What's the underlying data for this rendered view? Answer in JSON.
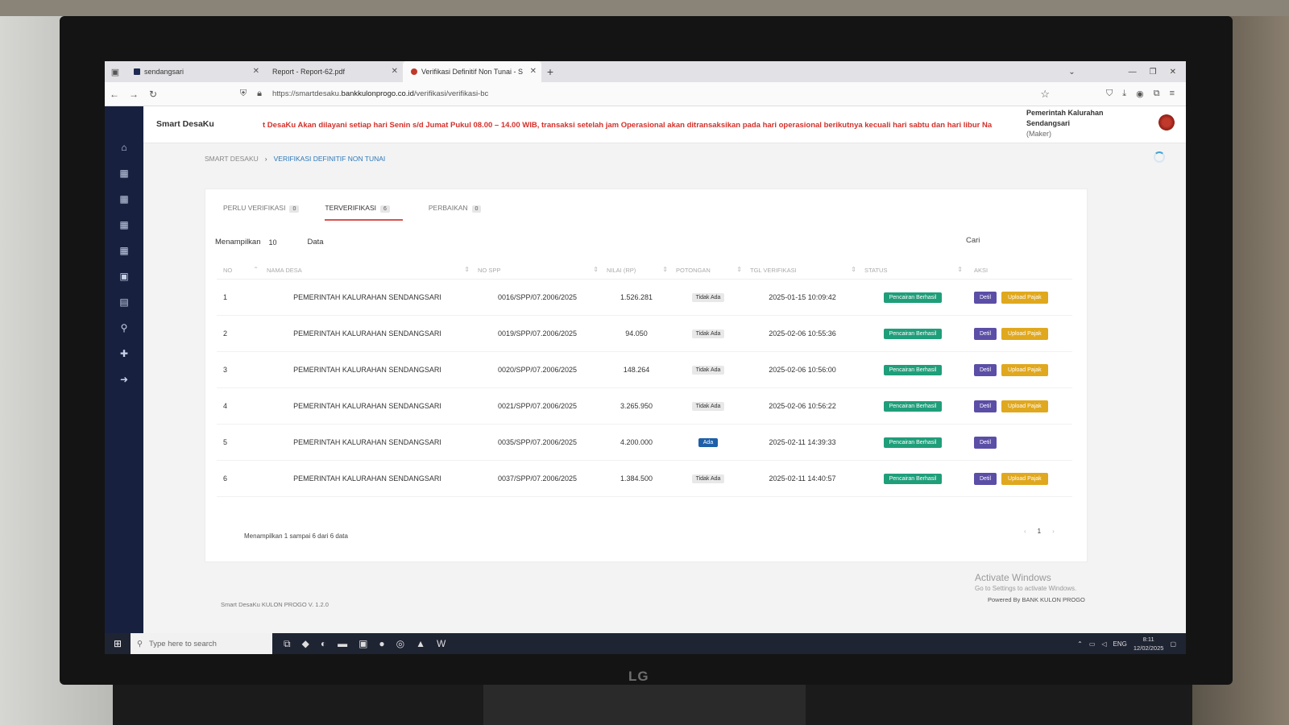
{
  "browser": {
    "tabs": [
      {
        "title": "sendangsari",
        "active": false
      },
      {
        "title": "Report - Report-62.pdf",
        "active": false
      },
      {
        "title": "Verifikasi Definitif Non Tunai - S",
        "active": true
      }
    ],
    "url_prefix": "https://smartdesaku.",
    "url_domain": "bankkulonprogo.co.id",
    "url_path": "/verifikasi/verifikasi-bc"
  },
  "header": {
    "brand": "Smart DesaKu",
    "announcement": "t DesaKu Akan dilayani setiap hari Senin s/d Jumat Pukul 08.00 – 14.00 WIB, transaksi setelah jam Operasional akan ditransaksikan pada hari operasional berikutnya kecuali hari sabtu dan hari libur Na",
    "user_line1": "Pemerintah Kalurahan",
    "user_line2": "Sendangsari",
    "user_role": "(Maker)"
  },
  "breadcrumb": {
    "root": "SMART DESAKU",
    "current": "VERIFIKASI DEFINITIF NON TUNAI"
  },
  "tabs": [
    {
      "label": "PERLU VERIFIKASI",
      "count": "0"
    },
    {
      "label": "TERVERIFIKASI",
      "count": "6"
    },
    {
      "label": "PERBAIKAN",
      "count": "0"
    }
  ],
  "controls": {
    "show_label": "Menampilkan",
    "page_size": "10",
    "data_label": "Data",
    "search_label": "Cari"
  },
  "columns": [
    "NO",
    "NAMA DESA",
    "NO SPP",
    "NILAI (RP)",
    "POTONGAN",
    "TGL VERIFIKASI",
    "STATUS",
    "AKSI"
  ],
  "rows": [
    {
      "no": "1",
      "desa": "PEMERINTAH KALURAHAN SENDANGSARI",
      "spp": "0016/SPP/07.2006/2025",
      "nilai": "1.526.281",
      "potongan": "Tidak Ada",
      "tgl": "2025-01-15 10:09:42",
      "status": "Pencairan Berhasil",
      "detil": "Detil",
      "upload": "Upload Pajak"
    },
    {
      "no": "2",
      "desa": "PEMERINTAH KALURAHAN SENDANGSARI",
      "spp": "0019/SPP/07.2006/2025",
      "nilai": "94.050",
      "potongan": "Tidak Ada",
      "tgl": "2025-02-06 10:55:36",
      "status": "Pencairan Berhasil",
      "detil": "Detil",
      "upload": "Upload Pajak"
    },
    {
      "no": "3",
      "desa": "PEMERINTAH KALURAHAN SENDANGSARI",
      "spp": "0020/SPP/07.2006/2025",
      "nilai": "148.264",
      "potongan": "Tidak Ada",
      "tgl": "2025-02-06 10:56:00",
      "status": "Pencairan Berhasil",
      "detil": "Detil",
      "upload": "Upload Pajak"
    },
    {
      "no": "4",
      "desa": "PEMERINTAH KALURAHAN SENDANGSARI",
      "spp": "0021/SPP/07.2006/2025",
      "nilai": "3.265.950",
      "potongan": "Tidak Ada",
      "tgl": "2025-02-06 10:56:22",
      "status": "Pencairan Berhasil",
      "detil": "Detil",
      "upload": "Upload Pajak"
    },
    {
      "no": "5",
      "desa": "PEMERINTAH KALURAHAN SENDANGSARI",
      "spp": "0035/SPP/07.2006/2025",
      "nilai": "4.200.000",
      "potongan": "Ada",
      "tgl": "2025-02-11 14:39:33",
      "status": "Pencairan Berhasil",
      "detil": "Detil",
      "upload": ""
    },
    {
      "no": "6",
      "desa": "PEMERINTAH KALURAHAN SENDANGSARI",
      "spp": "0037/SPP/07.2006/2025",
      "nilai": "1.384.500",
      "potongan": "Tidak Ada",
      "tgl": "2025-02-11 14:40:57",
      "status": "Pencairan Berhasil",
      "detil": "Detil",
      "upload": "Upload Pajak"
    }
  ],
  "footer": {
    "info": "Menampilkan 1 sampai 6 dari 6 data",
    "page": "1",
    "version": "Smart DesaKu KULON PROGO V. 1.2.0",
    "powered": "Powered By BANK KULON PROGO"
  },
  "watermark": {
    "title": "Activate Windows",
    "subtitle": "Go to Settings to activate Windows."
  },
  "taskbar": {
    "search_placeholder": "Type here to search",
    "lang": "ENG",
    "time": "8:11",
    "date": "12/02/2025"
  },
  "monitor_brand": "LG",
  "colors": {
    "sidebar": "#17213f",
    "status_green": "#1f9e7a",
    "detil_purple": "#5b4ea6",
    "upload_yellow": "#e0a81e",
    "announcement_red": "#d4302a"
  }
}
